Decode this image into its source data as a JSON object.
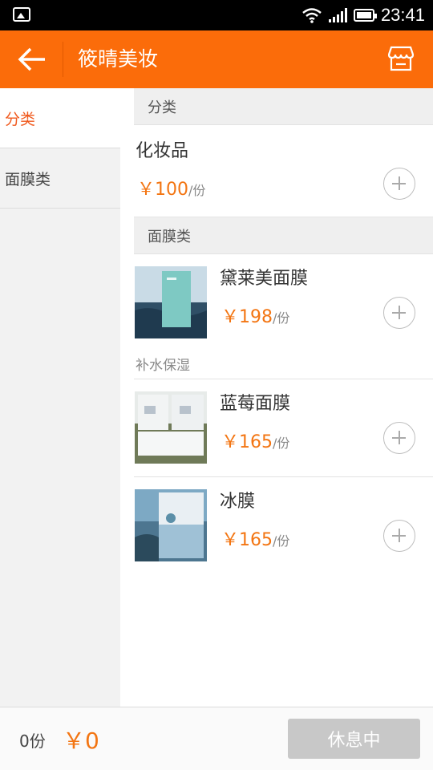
{
  "status_bar": {
    "time": "23:41"
  },
  "header": {
    "title": "筱晴美妆"
  },
  "sidebar": {
    "items": [
      {
        "label": "分类",
        "active": true
      },
      {
        "label": "面膜类",
        "active": false
      }
    ]
  },
  "sections": [
    {
      "title": "分类",
      "items": [
        {
          "name": "化妆品",
          "price": "￥100",
          "unit": "/份"
        }
      ]
    },
    {
      "title": "面膜类",
      "items": [
        {
          "name": "黛莱美面膜",
          "price": "￥198",
          "unit": "/份",
          "description": "补水保湿"
        },
        {
          "name": "蓝莓面膜",
          "price": "￥165",
          "unit": "/份"
        },
        {
          "name": "冰膜",
          "price": "￥165",
          "unit": "/份"
        }
      ]
    }
  ],
  "bottom_bar": {
    "count": "0份",
    "total": "￥0",
    "rest_label": "休息中"
  },
  "colors": {
    "accent": "#fb6c0a",
    "price": "#f37512",
    "active_sidebar": "#f05a1e",
    "button_disabled": "#c8c8c8"
  }
}
